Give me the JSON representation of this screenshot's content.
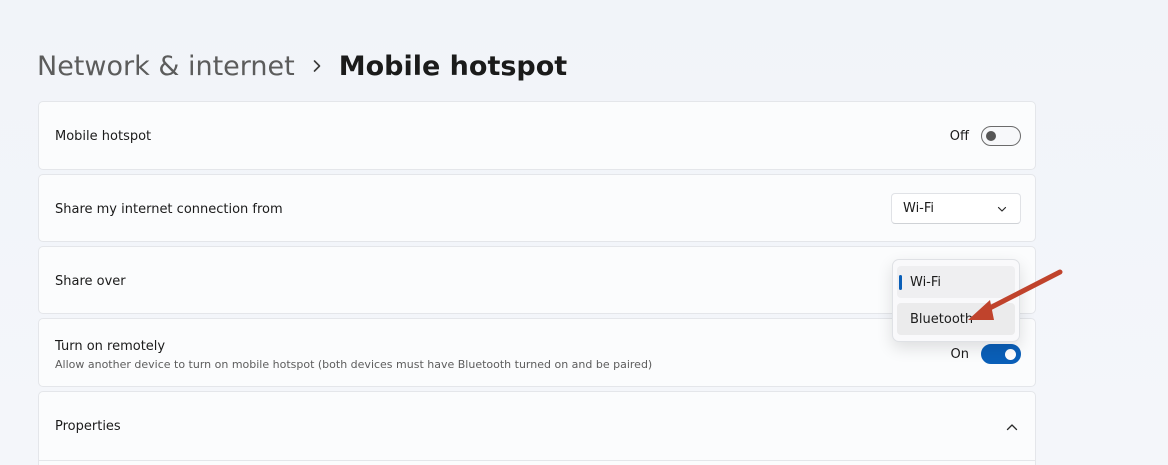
{
  "breadcrumb": {
    "parent": "Network & internet",
    "separator_icon": "chevron-right-icon",
    "current": "Mobile hotspot"
  },
  "settings": {
    "mobile_hotspot": {
      "label": "Mobile hotspot",
      "state_label": "Off",
      "enabled": false
    },
    "share_from": {
      "label": "Share my internet connection from",
      "selected": "Wi-Fi",
      "icon": "chevron-down-icon"
    },
    "share_over": {
      "label": "Share over",
      "options": [
        "Wi-Fi",
        "Bluetooth"
      ],
      "selected": "Wi-Fi",
      "hovered": "Bluetooth"
    },
    "turn_on_remotely": {
      "label": "Turn on remotely",
      "description": "Allow another device to turn on mobile hotspot (both devices must have Bluetooth turned on and be paired)",
      "state_label": "On",
      "enabled": true
    },
    "properties": {
      "label": "Properties",
      "icon": "chevron-up-icon"
    }
  },
  "colors": {
    "accent": "#0a5fb8",
    "annotation_arrow": "#c0432c"
  }
}
